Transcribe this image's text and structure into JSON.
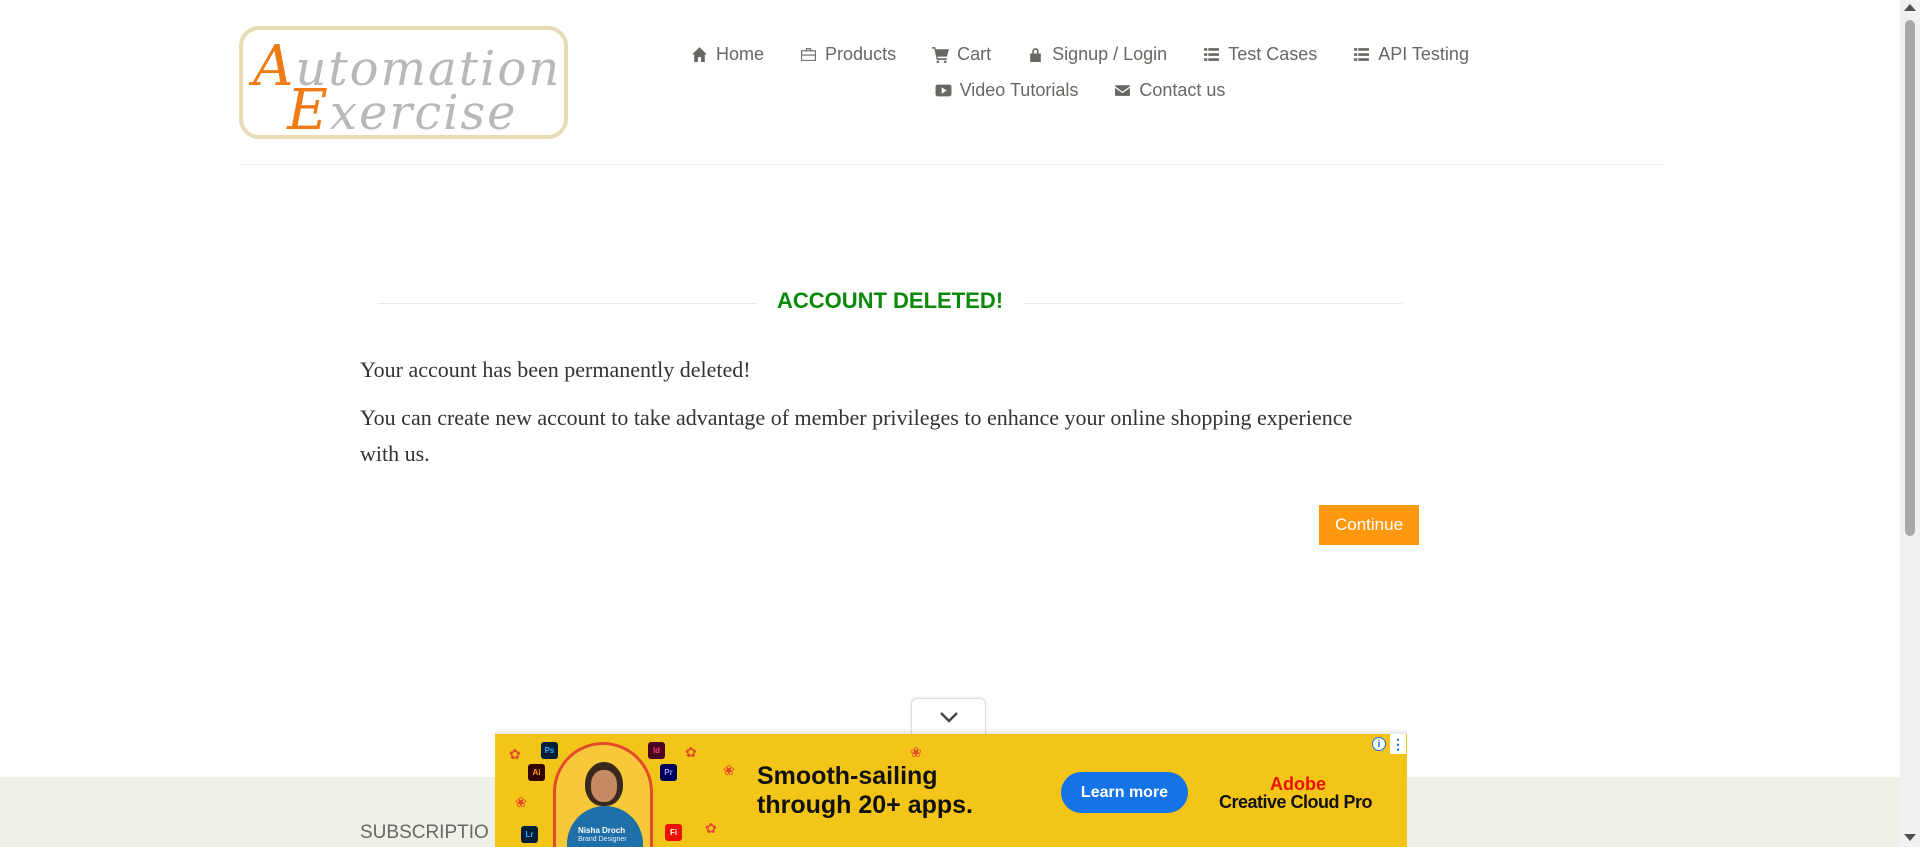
{
  "logo": {
    "line1_cap": "A",
    "line1_rest": "utomation",
    "line2_cap": "E",
    "line2_rest": "xercise"
  },
  "nav": {
    "row1": [
      {
        "label": "Home",
        "icon": "home-icon"
      },
      {
        "label": "Products",
        "icon": "briefcase-icon"
      },
      {
        "label": "Cart",
        "icon": "cart-icon"
      },
      {
        "label": "Signup / Login",
        "icon": "lock-icon"
      },
      {
        "label": "Test Cases",
        "icon": "list-icon"
      },
      {
        "label": "API Testing",
        "icon": "list-icon"
      }
    ],
    "row2": [
      {
        "label": "Video Tutorials",
        "icon": "youtube-play-icon"
      },
      {
        "label": "Contact us",
        "icon": "envelope-icon"
      }
    ]
  },
  "main": {
    "title": "ACCOUNT DELETED!",
    "message1": "Your account has been permanently deleted!",
    "message2": "You can create new account to take advantage of member privileges to enhance your online shopping experience with us.",
    "continue_label": "Continue"
  },
  "footer": {
    "subscription_label": "SUBSCRIPTIO"
  },
  "ad": {
    "headline_line1": "Smooth-sailing",
    "headline_line2": "through 20+ apps.",
    "cta_label": "Learn more",
    "brand_line1": "Adobe",
    "brand_line2": "Creative Cloud Pro",
    "person_name": "Nisha Droch",
    "person_role": "Brand Designer",
    "app_badges": [
      "Ps",
      "Id",
      "Ai",
      "Pr",
      "Lr",
      "Fi"
    ],
    "info_glyph": "i",
    "more_glyph": "⋮"
  },
  "colors": {
    "title_green": "#0a8a0a",
    "button_orange": "#fe980f",
    "ad_yellow": "#f3c518",
    "ad_button_blue": "#1473e6"
  }
}
